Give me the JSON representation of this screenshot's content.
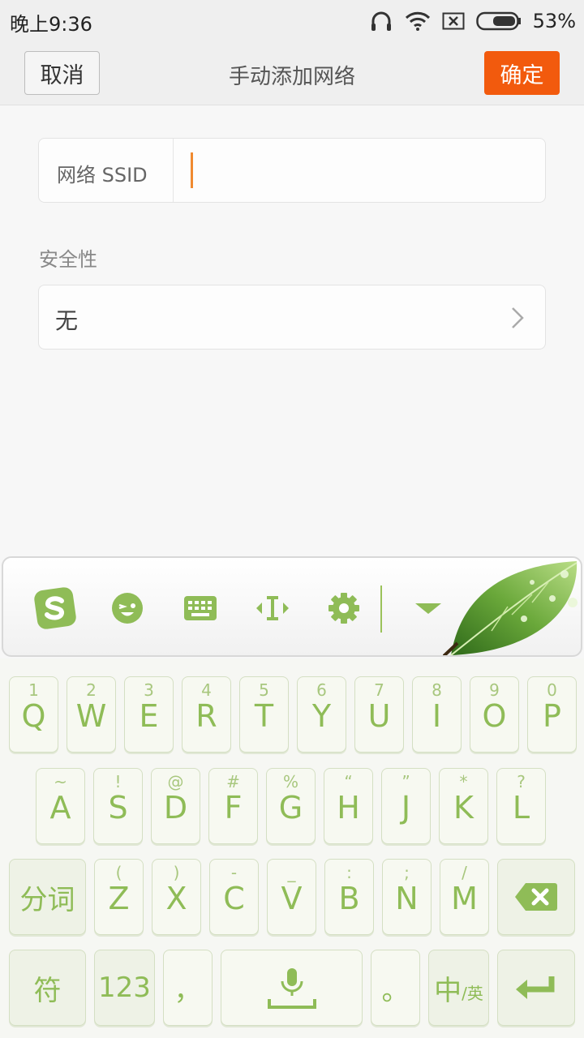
{
  "status": {
    "time": "晚上9:36",
    "battery": "53%",
    "icons": [
      "headphones-icon",
      "wifi-icon",
      "sim-off-icon",
      "battery-icon"
    ]
  },
  "header": {
    "cancel": "取消",
    "title": "手动添加网络",
    "confirm": "确定",
    "accent": "#f25a0d"
  },
  "form": {
    "ssid_label": "网络 SSID",
    "ssid_value": "",
    "security_heading": "安全性",
    "security_value": "无"
  },
  "keyboard": {
    "toolbar_icons": [
      "sogou-logo-icon",
      "emoji-icon",
      "keyboard-icon",
      "cursor-icon",
      "settings-icon",
      "collapse-icon"
    ],
    "accent": "#8fbc57",
    "row1": [
      {
        "main": "Q",
        "sub": "1"
      },
      {
        "main": "W",
        "sub": "2"
      },
      {
        "main": "E",
        "sub": "3"
      },
      {
        "main": "R",
        "sub": "4"
      },
      {
        "main": "T",
        "sub": "5"
      },
      {
        "main": "Y",
        "sub": "6"
      },
      {
        "main": "U",
        "sub": "7"
      },
      {
        "main": "I",
        "sub": "8"
      },
      {
        "main": "O",
        "sub": "9"
      },
      {
        "main": "P",
        "sub": "0"
      }
    ],
    "row2": [
      {
        "main": "A",
        "sub": "~"
      },
      {
        "main": "S",
        "sub": "!"
      },
      {
        "main": "D",
        "sub": "@"
      },
      {
        "main": "F",
        "sub": "#"
      },
      {
        "main": "G",
        "sub": "%"
      },
      {
        "main": "H",
        "sub": "“"
      },
      {
        "main": "J",
        "sub": "”"
      },
      {
        "main": "K",
        "sub": "*"
      },
      {
        "main": "L",
        "sub": "?"
      }
    ],
    "row3": [
      {
        "main": "Z",
        "sub": "("
      },
      {
        "main": "X",
        "sub": ")"
      },
      {
        "main": "C",
        "sub": "-"
      },
      {
        "main": "V",
        "sub": "_"
      },
      {
        "main": "B",
        "sub": ":"
      },
      {
        "main": "N",
        "sub": ";"
      },
      {
        "main": "M",
        "sub": "/"
      }
    ],
    "segment": "分词",
    "symbols": "符",
    "numbers": "123",
    "comma": "，",
    "period": "。",
    "lang_main": "中",
    "lang_sub": "/英"
  }
}
